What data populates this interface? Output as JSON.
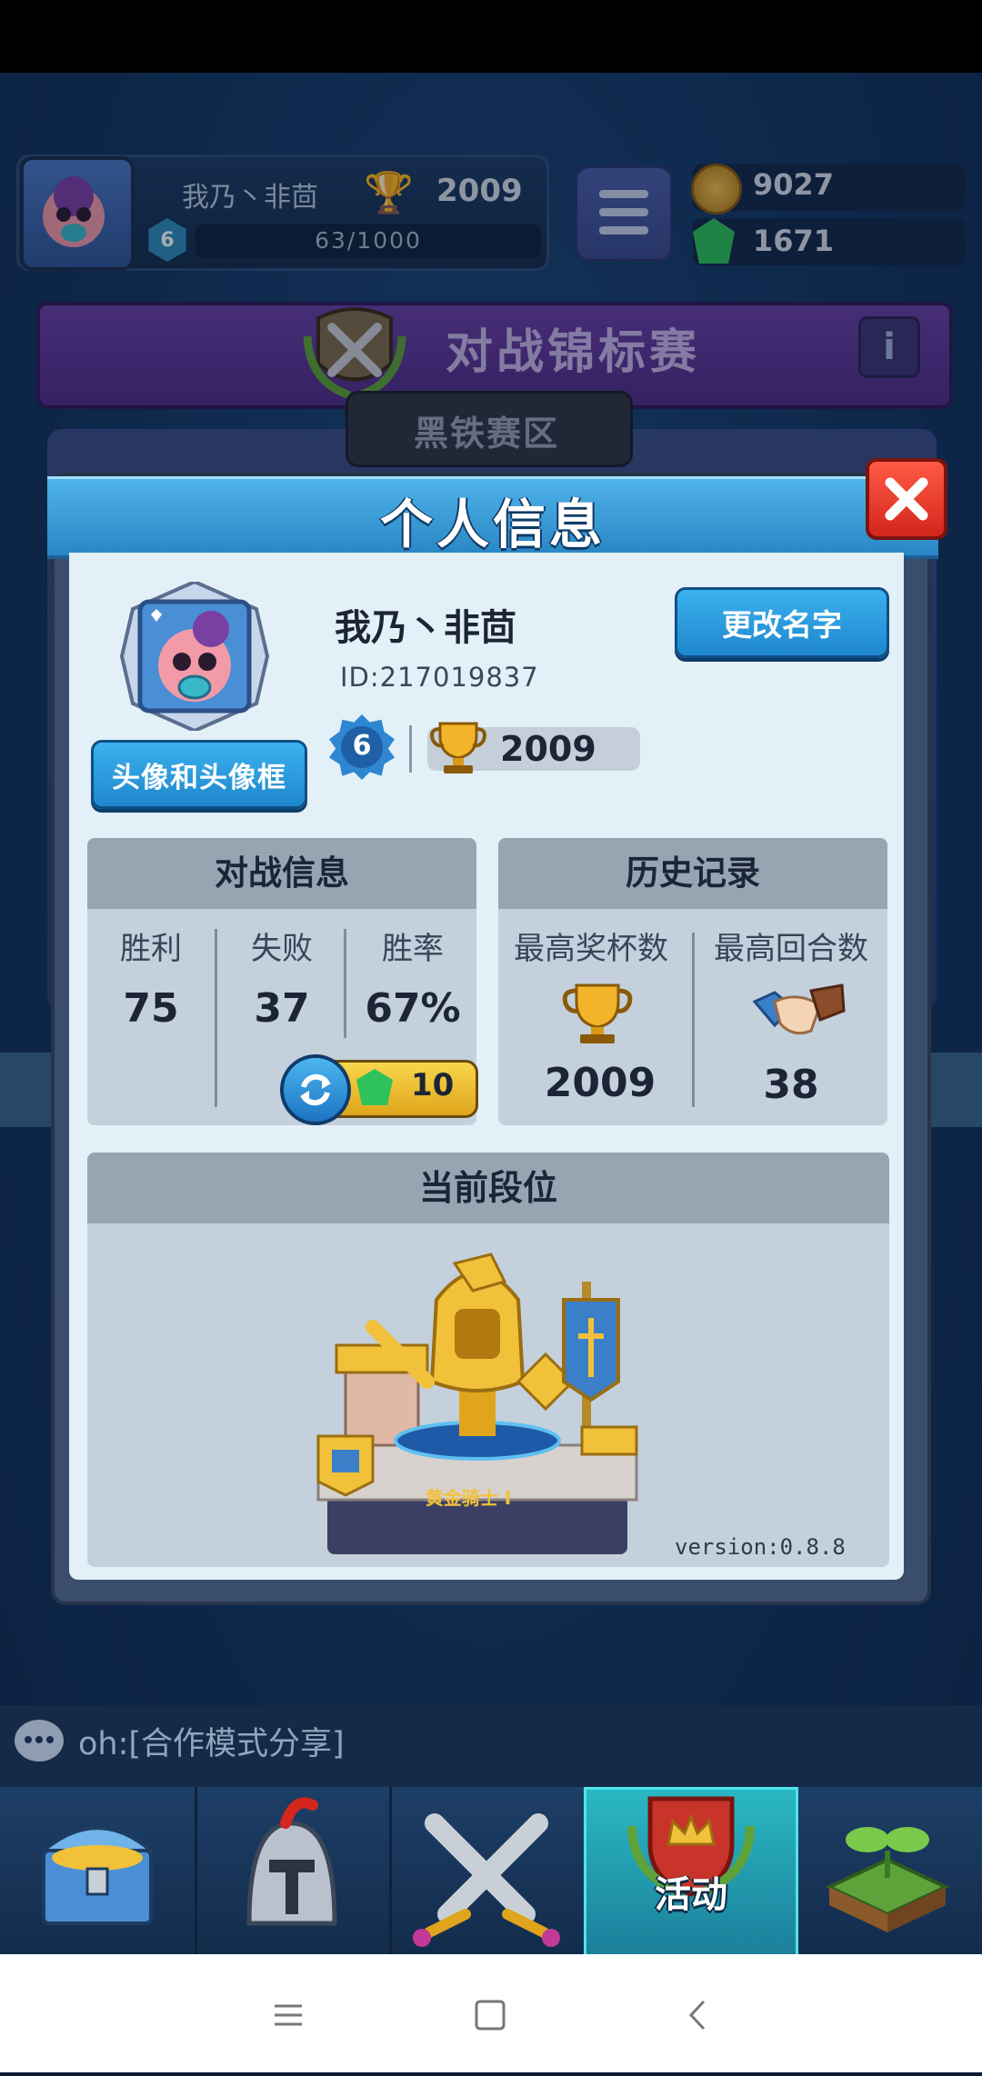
{
  "top_bar": {
    "player_name": "我乃丶非茴",
    "trophies": "2009",
    "level": "6",
    "xp": "63/1000",
    "coins": "9027",
    "gems": "1671"
  },
  "banner": {
    "title": "对战锦标赛",
    "league": "黑铁赛区"
  },
  "dialog": {
    "title": "个人信息",
    "avatar_button": "头像和头像框",
    "player_name": "我乃丶非茴",
    "player_id": "ID:217019837",
    "rename_button": "更改名字",
    "level": "6",
    "trophies": "2009"
  },
  "battle_info": {
    "title": "对战信息",
    "columns": [
      {
        "label": "胜利",
        "value": "75"
      },
      {
        "label": "失败",
        "value": "37"
      },
      {
        "label": "胜率",
        "value": "67%"
      }
    ],
    "reset_cost": "10"
  },
  "history": {
    "title": "历史记录",
    "columns": [
      {
        "label": "最高奖杯数",
        "value": "2009",
        "icon": "trophy-icon"
      },
      {
        "label": "最高回合数",
        "value": "38",
        "icon": "handshake-icon"
      }
    ]
  },
  "rank": {
    "title": "当前段位",
    "rank_name": "黄金骑士 I",
    "version": "version:0.8.8"
  },
  "chat": {
    "message": "oh:[合作模式分享]"
  },
  "bottom_nav": {
    "items": [
      {
        "icon": "chest-icon"
      },
      {
        "icon": "knight-helmet-icon"
      },
      {
        "icon": "crossed-swords-icon"
      },
      {
        "icon": "shield-crown-icon",
        "label": "活动",
        "active": true
      },
      {
        "icon": "sprout-icon"
      }
    ]
  },
  "colors": {
    "dialog_header": "#2a86c5",
    "button_blue": "#1f87cd",
    "close_red": "#d3261c",
    "panel_bg": "#c4d0dc",
    "panel_head": "#97a5b3",
    "trophy_gold": "#e7ad23",
    "gem_green": "#2fc25a"
  }
}
